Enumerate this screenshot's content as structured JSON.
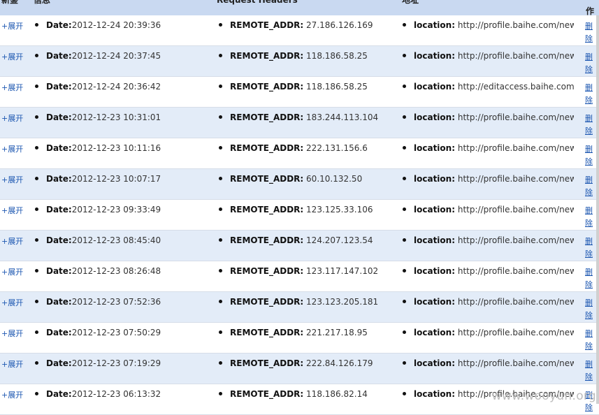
{
  "header": {
    "col_new": "新鉴",
    "col_info": "信息",
    "col_request": "Request Headers",
    "col_address": "地址",
    "col_op": "作"
  },
  "expand_label": "+展开",
  "delete_label": "删除",
  "date_key": "Date:",
  "request_key": "REMOTE_ADDR:",
  "location_key": "location:",
  "rows": [
    {
      "date": "2012-12-24 20:39:36",
      "ip": "27.186.126.169",
      "location": "http://profile.baihe.com/new/Basi"
    },
    {
      "date": "2012-12-24 20:37:45",
      "ip": "118.186.58.25",
      "location": "http://profile.baihe.com/new/Basi"
    },
    {
      "date": "2012-12-24 20:36:42",
      "ip": "118.186.58.25",
      "location": "http://editaccess.baihe.com/"
    },
    {
      "date": "2012-12-23 10:31:01",
      "ip": "183.244.113.104",
      "location": "http://profile.baihe.com/new/Basi"
    },
    {
      "date": "2012-12-23 10:11:16",
      "ip": "222.131.156.6",
      "location": "http://profile.baihe.com/new/Basi"
    },
    {
      "date": "2012-12-23 10:07:17",
      "ip": "60.10.132.50",
      "location": "http://profile.baihe.com/new/Basi"
    },
    {
      "date": "2012-12-23 09:33:49",
      "ip": "123.125.33.106",
      "location": "http://profile.baihe.com/new/Basi"
    },
    {
      "date": "2012-12-23 08:45:40",
      "ip": "124.207.123.54",
      "location": "http://profile.baihe.com/new/Basi"
    },
    {
      "date": "2012-12-23 08:26:48",
      "ip": "123.117.147.102",
      "location": "http://profile.baihe.com/new/Basi"
    },
    {
      "date": "2012-12-23 07:52:36",
      "ip": "123.123.205.181",
      "location": "http://profile.baihe.com/new/Basi"
    },
    {
      "date": "2012-12-23 07:50:29",
      "ip": "221.217.18.95",
      "location": "http://profile.baihe.com/new/Basi"
    },
    {
      "date": "2012-12-23 07:19:29",
      "ip": "222.84.126.179",
      "location": "http://profile.baihe.com/new/Basi"
    },
    {
      "date": "2012-12-23 06:13:32",
      "ip": "118.186.82.14",
      "location": "http://profile.baihe.com/new/Basi"
    }
  ],
  "watermark": "www.wooyun.org",
  "colors": {
    "header_bg": "#c9d9f1",
    "alt_row_bg": "#e3ecf8",
    "link": "#1a55b0"
  }
}
